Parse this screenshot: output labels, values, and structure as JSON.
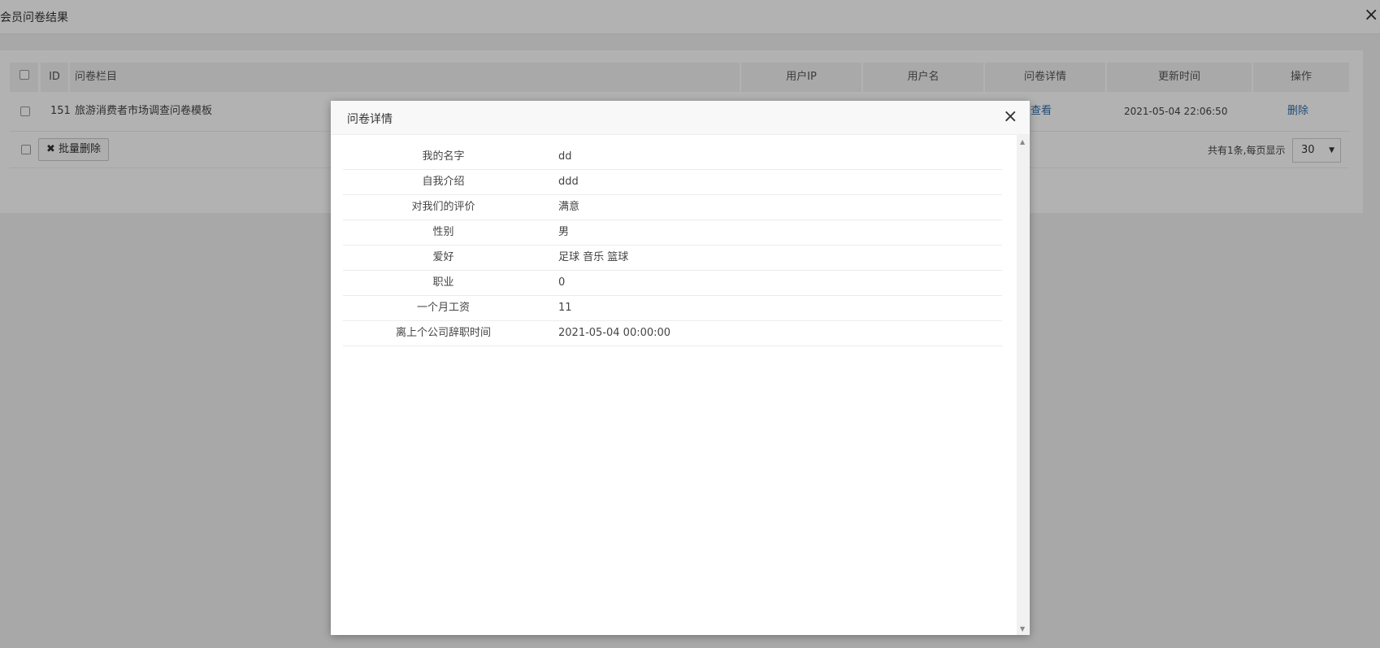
{
  "window": {
    "title": "会员问卷结果",
    "close_icon": "×"
  },
  "table": {
    "headers": [
      "ID",
      "问卷栏目",
      "用户IP",
      "用户名",
      "问卷详情",
      "更新时间",
      "操作"
    ],
    "rows": [
      {
        "id": "151",
        "column": "旅游消费者市场调查问卷模板",
        "ip": "",
        "username": "",
        "detail_link": "查看",
        "updated": "2021-05-04 22:06:50",
        "action": "删除"
      }
    ]
  },
  "footer": {
    "batch_delete_icon": "✖",
    "batch_delete_label": "批量删除",
    "total_text": "共有1条,每页显示",
    "per_page_value": "30",
    "per_page_arrow": "▼"
  },
  "modal": {
    "title": "问卷详情",
    "close_icon": "×",
    "fields": [
      {
        "label": "我的名字",
        "value": "dd"
      },
      {
        "label": "自我介绍",
        "value": "ddd"
      },
      {
        "label": "对我们的评价",
        "value": "满意"
      },
      {
        "label": "性别",
        "value": "男"
      },
      {
        "label": "爱好",
        "value": "足球 音乐 篮球"
      },
      {
        "label": "职业",
        "value": "0"
      },
      {
        "label": "一个月工资",
        "value": "11"
      },
      {
        "label": "离上个公司辞职时间",
        "value": "2021-05-04 00:00:00"
      }
    ]
  },
  "colors": {
    "link": "#2f6ea8",
    "overlay": "rgba(0,0,0,0.3)",
    "header_bg": "#f2f2f2"
  }
}
